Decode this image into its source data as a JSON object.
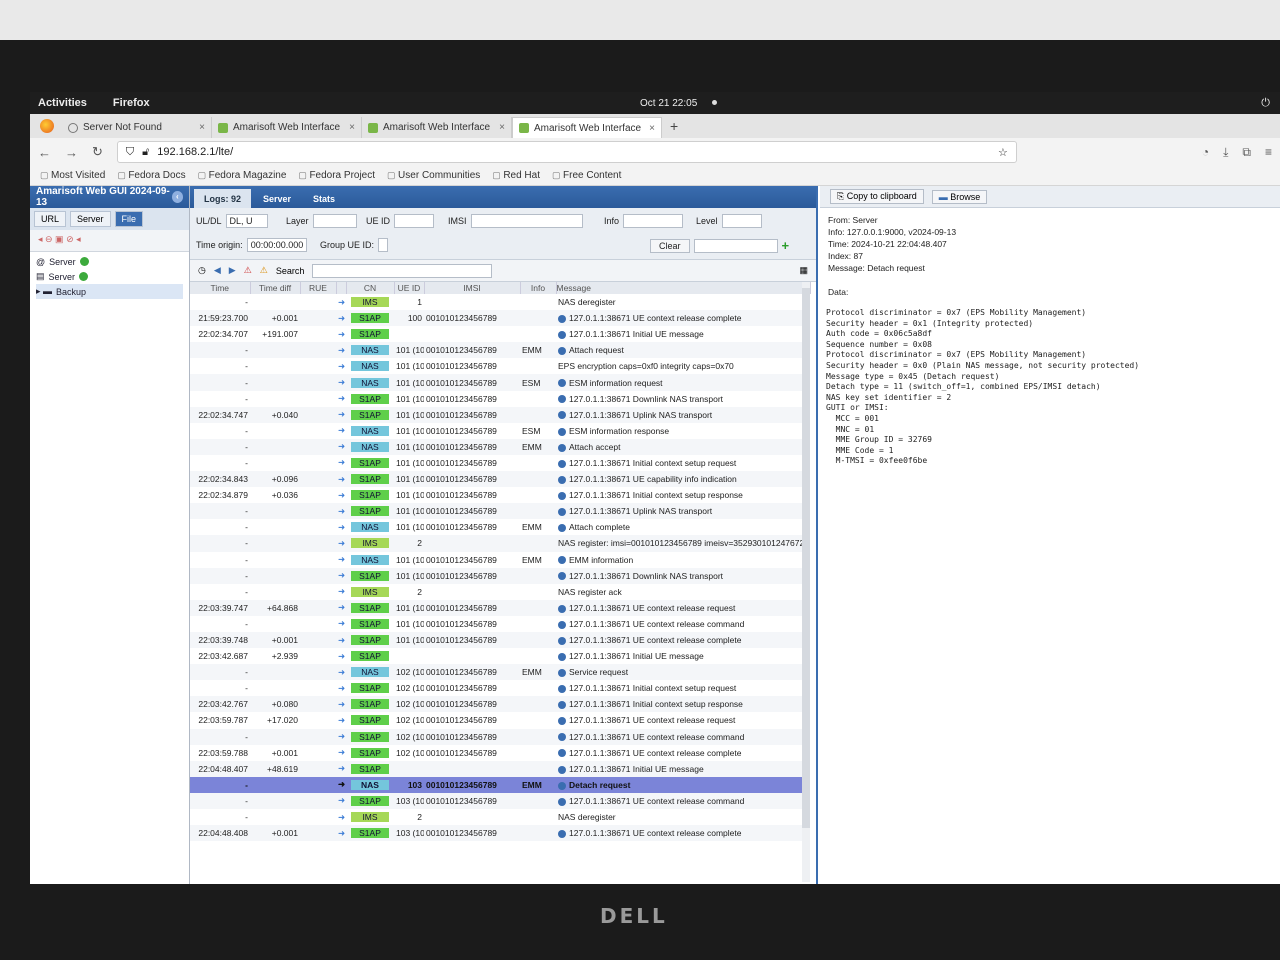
{
  "gnome": {
    "activities": "Activities",
    "app": "Firefox",
    "clock": "Oct 21  22:05"
  },
  "browser": {
    "tabs": [
      {
        "label": "Server Not Found"
      },
      {
        "label": "Amarisoft Web Interface"
      },
      {
        "label": "Amarisoft Web Interface"
      },
      {
        "label": "Amarisoft Web Interface"
      }
    ],
    "url": "192.168.2.1/lte/",
    "bookmarks": [
      "Most Visited",
      "Fedora Docs",
      "Fedora Magazine",
      "Fedora Project",
      "User Communities",
      "Red Hat",
      "Free Content"
    ]
  },
  "left": {
    "title": "Amarisoft Web GUI 2024-09-13",
    "tabs": [
      "URL",
      "Server",
      "File"
    ],
    "tree": [
      "Server",
      "Server",
      "Backup"
    ]
  },
  "main": {
    "tabs": [
      "Logs: 92",
      "Server",
      "Stats"
    ],
    "filters": {
      "uldl_label": "UL/DL",
      "uldl_value": "DL, U",
      "layer_label": "Layer",
      "ueid_label": "UE ID",
      "imsi_label": "IMSI",
      "info_label": "Info",
      "level_label": "Level",
      "time_origin_label": "Time origin:",
      "time_origin_value": "00:00:00.000",
      "group_label": "Group UE ID:",
      "clear_label": "Clear",
      "search_label": "Search"
    },
    "columns": [
      "Time",
      "Time diff",
      "RUE",
      "CN",
      "UE ID",
      "IMSI",
      "Info",
      "Message"
    ],
    "rows": [
      {
        "time": "-",
        "diff": "",
        "cn": "IMS",
        "ueid": "1",
        "imsi": "",
        "info": "",
        "msg": "NAS deregister",
        "i": false
      },
      {
        "time": "21:59:23.700",
        "diff": "+0.001",
        "cn": "S1AP",
        "ueid": "100",
        "imsi": "001010123456789",
        "info": "",
        "msg": "127.0.1.1:38671 UE context release complete",
        "i": true
      },
      {
        "time": "22:02:34.707",
        "diff": "+191.007",
        "cn": "S1AP",
        "ueid": "",
        "imsi": "",
        "info": "",
        "msg": "127.0.1.1:38671 Initial UE message",
        "i": true
      },
      {
        "time": "-",
        "diff": "",
        "cn": "NAS",
        "ueid": "101 (100)",
        "imsi": "001010123456789",
        "info": "EMM",
        "msg": "Attach request",
        "i": true
      },
      {
        "time": "-",
        "diff": "",
        "cn": "NAS",
        "ueid": "101 (100)",
        "imsi": "001010123456789",
        "info": "",
        "msg": "EPS encryption caps=0xf0 integrity caps=0x70",
        "i": false
      },
      {
        "time": "-",
        "diff": "",
        "cn": "NAS",
        "ueid": "101 (100)",
        "imsi": "001010123456789",
        "info": "ESM",
        "msg": "ESM information request",
        "i": true
      },
      {
        "time": "-",
        "diff": "",
        "cn": "S1AP",
        "ueid": "101 (100)",
        "imsi": "001010123456789",
        "info": "",
        "msg": "127.0.1.1:38671 Downlink NAS transport",
        "i": true
      },
      {
        "time": "22:02:34.747",
        "diff": "+0.040",
        "cn": "S1AP",
        "ueid": "101 (100)",
        "imsi": "001010123456789",
        "info": "",
        "msg": "127.0.1.1:38671 Uplink NAS transport",
        "i": true
      },
      {
        "time": "-",
        "diff": "",
        "cn": "NAS",
        "ueid": "101 (100)",
        "imsi": "001010123456789",
        "info": "ESM",
        "msg": "ESM information response",
        "i": true
      },
      {
        "time": "-",
        "diff": "",
        "cn": "NAS",
        "ueid": "101 (100)",
        "imsi": "001010123456789",
        "info": "EMM",
        "msg": "Attach accept",
        "i": true
      },
      {
        "time": "-",
        "diff": "",
        "cn": "S1AP",
        "ueid": "101 (100)",
        "imsi": "001010123456789",
        "info": "",
        "msg": "127.0.1.1:38671 Initial context setup request",
        "i": true
      },
      {
        "time": "22:02:34.843",
        "diff": "+0.096",
        "cn": "S1AP",
        "ueid": "101 (100)",
        "imsi": "001010123456789",
        "info": "",
        "msg": "127.0.1.1:38671 UE capability info indication",
        "i": true
      },
      {
        "time": "22:02:34.879",
        "diff": "+0.036",
        "cn": "S1AP",
        "ueid": "101 (100)",
        "imsi": "001010123456789",
        "info": "",
        "msg": "127.0.1.1:38671 Initial context setup response",
        "i": true
      },
      {
        "time": "-",
        "diff": "",
        "cn": "S1AP",
        "ueid": "101 (100)",
        "imsi": "001010123456789",
        "info": "",
        "msg": "127.0.1.1:38671 Uplink NAS transport",
        "i": true
      },
      {
        "time": "-",
        "diff": "",
        "cn": "NAS",
        "ueid": "101 (100)",
        "imsi": "001010123456789",
        "info": "EMM",
        "msg": "Attach complete",
        "i": true
      },
      {
        "time": "-",
        "diff": "",
        "cn": "IMS",
        "ueid": "2",
        "imsi": "",
        "info": "",
        "msg": "NAS register: imsi=001010123456789 imeisv=352930101247672",
        "i": false
      },
      {
        "time": "-",
        "diff": "",
        "cn": "NAS",
        "ueid": "101 (100)",
        "imsi": "001010123456789",
        "info": "EMM",
        "msg": "EMM information",
        "i": true
      },
      {
        "time": "-",
        "diff": "",
        "cn": "S1AP",
        "ueid": "101 (100)",
        "imsi": "001010123456789",
        "info": "",
        "msg": "127.0.1.1:38671 Downlink NAS transport",
        "i": true
      },
      {
        "time": "-",
        "diff": "",
        "cn": "IMS",
        "ueid": "2",
        "imsi": "",
        "info": "",
        "msg": "NAS register ack",
        "i": false
      },
      {
        "time": "22:03:39.747",
        "diff": "+64.868",
        "cn": "S1AP",
        "ueid": "101 (100)",
        "imsi": "001010123456789",
        "info": "",
        "msg": "127.0.1.1:38671 UE context release request",
        "i": true
      },
      {
        "time": "-",
        "diff": "",
        "cn": "S1AP",
        "ueid": "101 (100)",
        "imsi": "001010123456789",
        "info": "",
        "msg": "127.0.1.1:38671 UE context release command",
        "i": true
      },
      {
        "time": "22:03:39.748",
        "diff": "+0.001",
        "cn": "S1AP",
        "ueid": "101 (100)",
        "imsi": "001010123456789",
        "info": "",
        "msg": "127.0.1.1:38671 UE context release complete",
        "i": true
      },
      {
        "time": "22:03:42.687",
        "diff": "+2.939",
        "cn": "S1AP",
        "ueid": "",
        "imsi": "",
        "info": "",
        "msg": "127.0.1.1:38671 Initial UE message",
        "i": true
      },
      {
        "time": "-",
        "diff": "",
        "cn": "NAS",
        "ueid": "102 (100)",
        "imsi": "001010123456789",
        "info": "EMM",
        "msg": "Service request",
        "i": true
      },
      {
        "time": "-",
        "diff": "",
        "cn": "S1AP",
        "ueid": "102 (100)",
        "imsi": "001010123456789",
        "info": "",
        "msg": "127.0.1.1:38671 Initial context setup request",
        "i": true
      },
      {
        "time": "22:03:42.767",
        "diff": "+0.080",
        "cn": "S1AP",
        "ueid": "102 (100)",
        "imsi": "001010123456789",
        "info": "",
        "msg": "127.0.1.1:38671 Initial context setup response",
        "i": true
      },
      {
        "time": "22:03:59.787",
        "diff": "+17.020",
        "cn": "S1AP",
        "ueid": "102 (100)",
        "imsi": "001010123456789",
        "info": "",
        "msg": "127.0.1.1:38671 UE context release request",
        "i": true
      },
      {
        "time": "-",
        "diff": "",
        "cn": "S1AP",
        "ueid": "102 (100)",
        "imsi": "001010123456789",
        "info": "",
        "msg": "127.0.1.1:38671 UE context release command",
        "i": true
      },
      {
        "time": "22:03:59.788",
        "diff": "+0.001",
        "cn": "S1AP",
        "ueid": "102 (100)",
        "imsi": "001010123456789",
        "info": "",
        "msg": "127.0.1.1:38671 UE context release complete",
        "i": true
      },
      {
        "time": "22:04:48.407",
        "diff": "+48.619",
        "cn": "S1AP",
        "ueid": "",
        "imsi": "",
        "info": "",
        "msg": "127.0.1.1:38671 Initial UE message",
        "i": true
      },
      {
        "time": "-",
        "diff": "",
        "cn": "NAS",
        "ueid": "103",
        "imsi": "001010123456789",
        "info": "EMM",
        "msg": "Detach request",
        "i": true,
        "hl": true
      },
      {
        "time": "-",
        "diff": "",
        "cn": "S1AP",
        "ueid": "103 (100)",
        "imsi": "001010123456789",
        "info": "",
        "msg": "127.0.1.1:38671 UE context release command",
        "i": true
      },
      {
        "time": "-",
        "diff": "",
        "cn": "IMS",
        "ueid": "2",
        "imsi": "",
        "info": "",
        "msg": "NAS deregister",
        "i": false
      },
      {
        "time": "22:04:48.408",
        "diff": "+0.001",
        "cn": "S1AP",
        "ueid": "103 (100)",
        "imsi": "001010123456789",
        "info": "",
        "msg": "127.0.1.1:38671 UE context release complete",
        "i": true
      }
    ]
  },
  "right": {
    "copy_label": "Copy to clipboard",
    "browse_label": "Browse",
    "meta": [
      "From: Server",
      "Info: 127.0.0.1:9000, v2024-09-13",
      "Time: 2024-10-21 22:04:48.407",
      "Index: 87",
      "Message: Detach request",
      "",
      "Data:"
    ],
    "detail": [
      "Protocol discriminator = 0x7 (EPS Mobility Management)",
      "Security header = 0x1 (Integrity protected)",
      "Auth code = 0x06c5a8df",
      "Sequence number = 0x08",
      "Protocol discriminator = 0x7 (EPS Mobility Management)",
      "Security header = 0x0 (Plain NAS message, not security protected)",
      "Message type = 0x45 (Detach request)",
      "Detach type = 11 (switch_off=1, combined EPS/IMSI detach)",
      "NAS key set identifier = 2",
      "GUTI or IMSI:",
      "  MCC = 001",
      "  MNC = 01",
      "  MME Group ID = 32769",
      "  MME Code = 1",
      "  M-TMSI = 0xfee0f6be"
    ]
  },
  "monitor": {
    "brand": "DELL"
  }
}
